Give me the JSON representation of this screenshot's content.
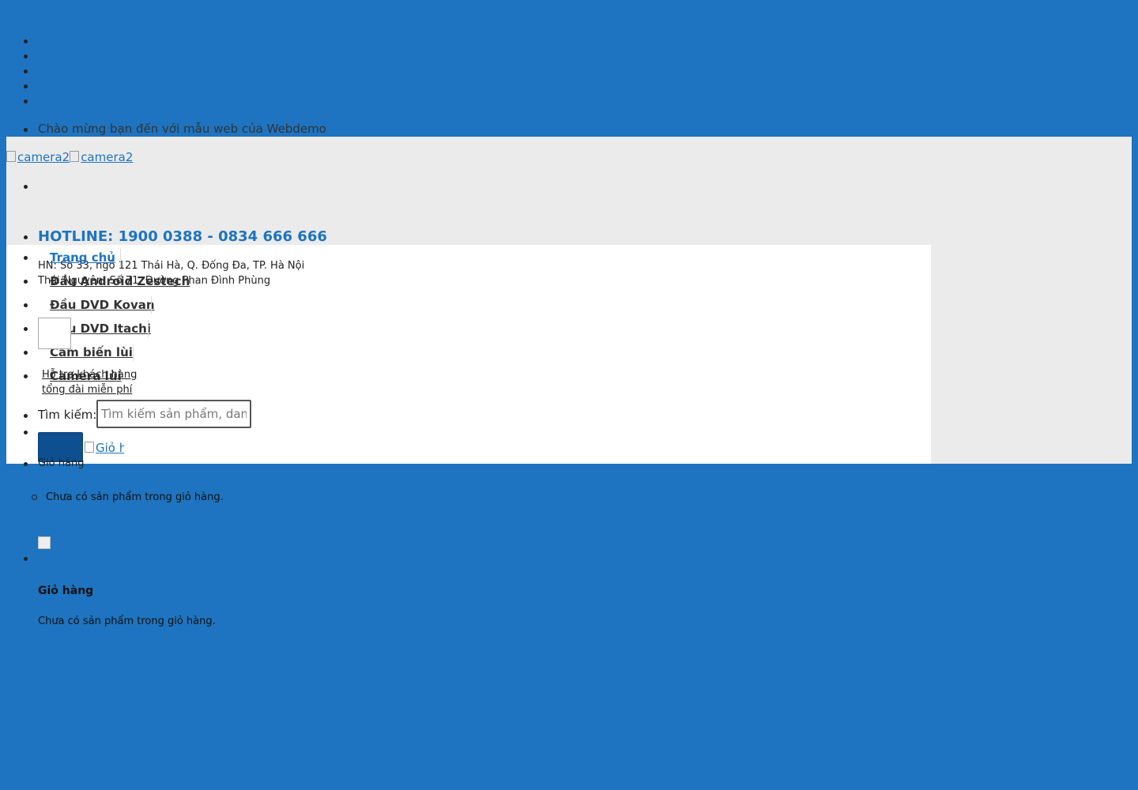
{
  "topbar": {
    "welcome_text": "Chào mừng bạn đến với mẫu web của Webdemo"
  },
  "header": {
    "logo_alt_1": "camera2",
    "logo_alt_2": "camera2",
    "hotline": "HOTLINE: 1900 0388 - 0834 666 666",
    "addresses": [
      "HN: Số 33, ngõ 121 Thái Hà, Q. Đống Đa, TP. Hà Nội",
      "Thái Nguyên: Số 71, Đường Phan Đình Phùng"
    ]
  },
  "nav": {
    "items": [
      "Trang chủ",
      "Đầu Android Zestech",
      "Đầu DVD Kovan",
      "Đầu DVD Itachi",
      "Cảm biến lùi",
      "Camera lùi"
    ]
  },
  "support": {
    "line1": "Hỗ trợ khách hàng",
    "line2": "tổng đài miễn phí"
  },
  "search": {
    "label": "Tìm kiếm:",
    "placeholder": "Tìm kiếm sản phẩm, danh mục..."
  },
  "cart": {
    "link_alt": "Giỏ hàng",
    "title": "Giỏ hàng",
    "empty_message": "Chưa có sản phẩm trong giỏ hàng.",
    "heading": "Giỏ hàng",
    "empty_message_2": "Chưa có sản phẩm trong giỏ hàng."
  },
  "colors": {
    "primary": "#1e74c0",
    "button": "#0d4f91",
    "band": "#ebebeb"
  }
}
